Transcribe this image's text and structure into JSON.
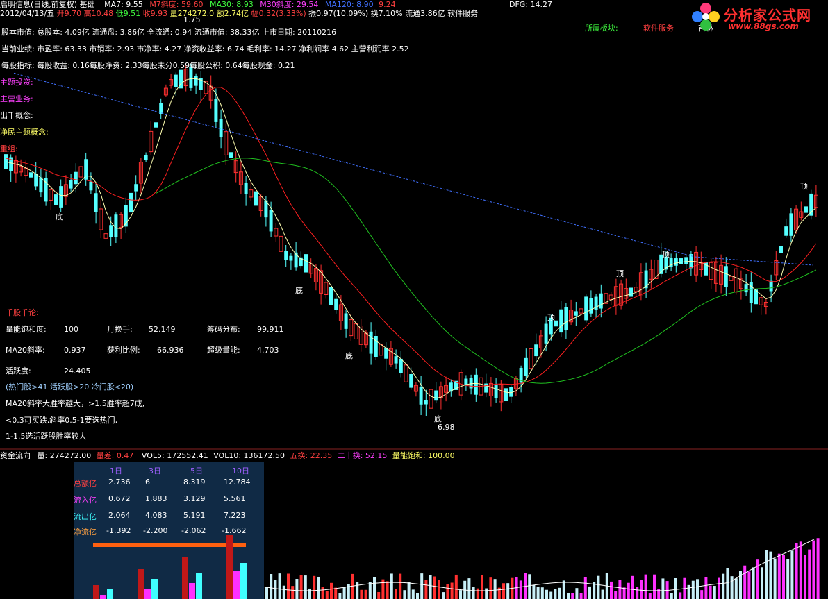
{
  "header": {
    "title": "启明信息(日线,前复权)",
    "tab": "基础",
    "ma7": "MA7: 9.55",
    "m7slope": "M7斜度: 59.60",
    "ma30": "MA30: 8.93",
    "m30slope": "M30斜度: 29.54",
    "ma120": "MA120: 8.90",
    "ma120b": "9.24",
    "dfg": "DFG: 14.27"
  },
  "quote_line": {
    "date": "2012/04/13/五",
    "open": "开9.70",
    "high": "高10.48",
    "low": "低9.51",
    "close": "收9.93",
    "volume": "量274272.0",
    "amount": "额2.74亿",
    "change": "幅0.32(3.33%)",
    "amplitude": "振0.97(10.09%)",
    "turnover": "换7.10%",
    "float": "流通3.86亿",
    "industry": "软件服务"
  },
  "sector_line": {
    "label1": "所属板块:",
    "value1": "软件服务",
    "value2": "吉林"
  },
  "info_lines": [
    "股本市值: 总股本: 4.09亿 流通盘: 3.86亿 全流通: 0.94 流通市值: 38.33亿 上市日期: 20110216",
    "当前业绩: 市盈率: 63.33 市销率: 2.93 市净率: 4.27 净资收益率: 6.74 毛利率: 14.27 净利润率 4.62 主营利润率 2.52",
    "每股指标: 每股收益: 0.16每股净资: 2.33每股未分0.59每股公积: 0.64每股现金: 0.21"
  ],
  "concept_lines": [
    "主题投资:",
    "主营业务:",
    "出千概念:",
    "净民主题概念:",
    "重组:"
  ],
  "chart_marks": {
    "bottom": "底",
    "top": "顶",
    "high_value": "1.75",
    "low_value": "6.98"
  },
  "analysis": {
    "title": "千股千论:",
    "rows": [
      {
        "k1": "量能饱和度:",
        "v1": "100",
        "k2": "月换手:",
        "v2": "52.149",
        "k3": "筹码分布:",
        "v3": "99.911"
      },
      {
        "k1": "MA20斜率:",
        "v1": "0.937",
        "k2": "获利比例:",
        "v2": "66.936",
        "k3": "超级量能:",
        "v3": "4.703"
      }
    ],
    "activity_label": "活跃度:",
    "activity_value": "24.405",
    "notes": [
      "(热门股>41 活跃股>20 冷门股<20)",
      "MA20斜率大胜率越大，>1.5胜率超7成,",
      "<0.3可买跌,斜率0.5-1要选热门,",
      "1-1.5选活跃股胜率较大"
    ]
  },
  "volume_header": {
    "name": "资金流向",
    "vol": "量: 274272.00",
    "diff": "量差: 0.47",
    "vol5": "VOL5: 172552.41",
    "vol10": "VOL10: 136172.50",
    "turn5": "五换: 22.35",
    "turn20": "二十换: 52.15",
    "saturation": "量能饱和: 100.00"
  },
  "flow_table": {
    "headers": [
      "1日",
      "3日",
      "5日",
      "10日"
    ],
    "rows": [
      {
        "label": "总额亿",
        "values": [
          "2.736",
          "6",
          "8.319",
          "12.784"
        ]
      },
      {
        "label": "流入亿",
        "values": [
          "0.672",
          "1.883",
          "3.129",
          "5.561"
        ]
      },
      {
        "label": "流出亿",
        "values": [
          "2.064",
          "4.083",
          "5.191",
          "7.223"
        ]
      },
      {
        "label": "净流亿",
        "values": [
          "-1.392",
          "-2.200",
          "-2.062",
          "-1.662"
        ]
      }
    ]
  },
  "logo": {
    "name": "分析家公式网",
    "url": "www.88gs.com"
  },
  "colors": {
    "up": "#ff3030",
    "down": "#54ffff",
    "ma_fast": "#ffffb0",
    "ma_mid": "#ff2020",
    "ma_slow": "#20c020",
    "ma_long": "#4070ff"
  }
}
